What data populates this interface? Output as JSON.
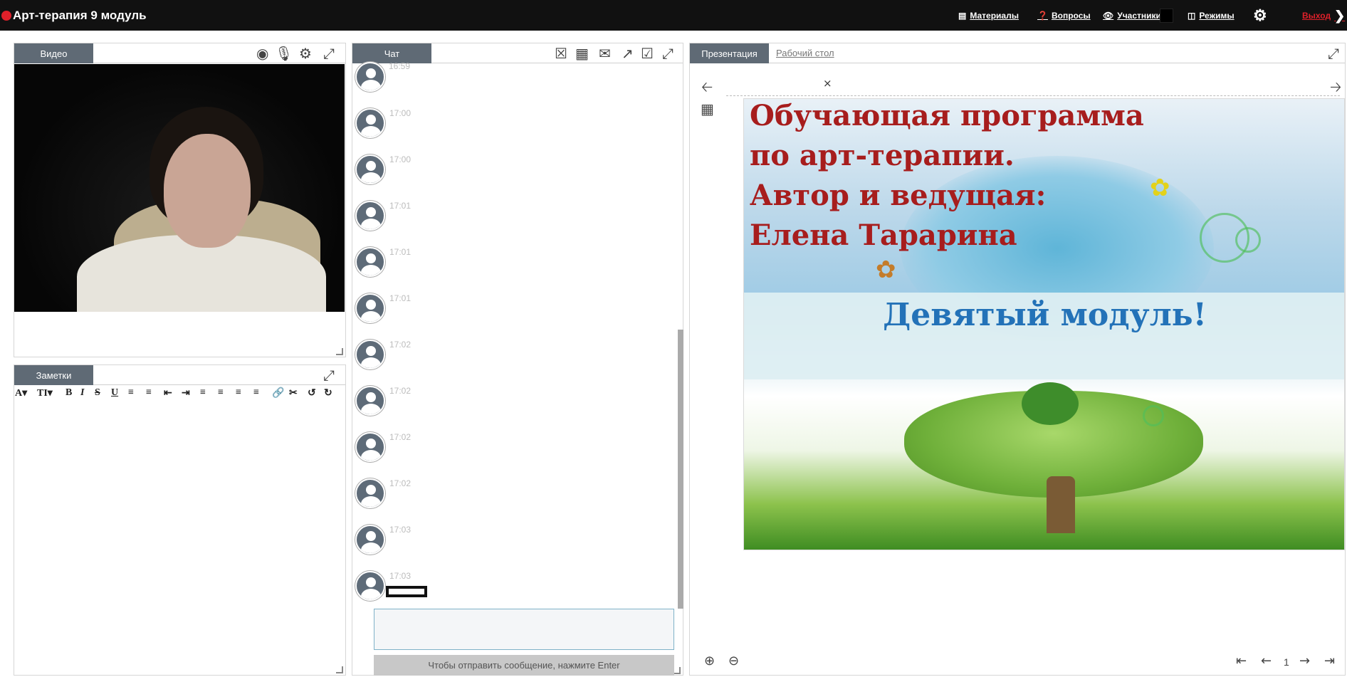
{
  "app": {
    "title": "Арт-терапия 9 модуль"
  },
  "topnav": {
    "materials": "Материалы",
    "questions": "Вопросы",
    "participants": "Участники (",
    "modes": "Режимы",
    "exit": "Выход"
  },
  "video_panel": {
    "tab": "Видео"
  },
  "notes_panel": {
    "tab": "Заметки",
    "toolbar": [
      "A▾",
      "TI▾",
      "B",
      "I",
      "S",
      "U"
    ]
  },
  "chat_panel": {
    "tab": "Чат",
    "top_cut_time": "16:59",
    "messages": [
      {
        "time": "17:00"
      },
      {
        "time": "17:00"
      },
      {
        "time": "17:01"
      },
      {
        "time": "17:01"
      },
      {
        "time": "17:01"
      },
      {
        "time": "17:02"
      },
      {
        "time": "17:02"
      },
      {
        "time": "17:02"
      },
      {
        "time": "17:02"
      },
      {
        "time": "17:03"
      },
      {
        "time": "17:03"
      }
    ],
    "send_hint": "Чтобы отправить сообщение, нажмите Enter"
  },
  "presentation_panel": {
    "tab_active": "Презентация",
    "tab_other": "Рабочий стол",
    "close_symbol": "×",
    "slide": {
      "line1": "Обучающая программа",
      "line2": "по арт-терапии.",
      "line3": "Автор и ведущая:",
      "line4": "Елена Тараринa",
      "subtitle": "Девятый модуль!"
    },
    "page_number": "1"
  },
  "colors": {
    "topbar": "#111111",
    "record": "#e0202a",
    "tab": "#5f6a75",
    "slide_title": "#a71d1d",
    "slide_subtitle": "#2372b8"
  }
}
